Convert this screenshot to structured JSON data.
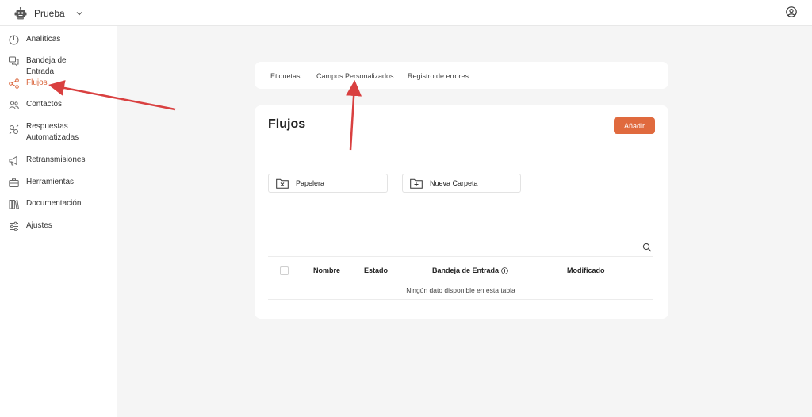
{
  "header": {
    "workspace_name": "Prueba",
    "workspace_icon": "robot-icon",
    "account_icon": "user-circle-icon"
  },
  "sidebar": {
    "items": [
      {
        "label": "Analíticas",
        "icon": "chart-pie-icon"
      },
      {
        "label": "Bandeja de Entrada",
        "icon": "chat-bubbles-icon"
      },
      {
        "label": "Flujos",
        "icon": "flow-nodes-icon",
        "active": true
      },
      {
        "label": "Contactos",
        "icon": "users-icon"
      },
      {
        "label": "Respuestas Automatizadas",
        "icon": "auto-reply-icon"
      },
      {
        "label": "Retransmisiones",
        "icon": "megaphone-icon"
      },
      {
        "label": "Herramientas",
        "icon": "toolbox-icon"
      },
      {
        "label": "Documentación",
        "icon": "books-icon"
      },
      {
        "label": "Ajustes",
        "icon": "sliders-icon"
      }
    ]
  },
  "tabs": [
    "Etiquetas",
    "Campos Personalizados",
    "Registro de errores"
  ],
  "main": {
    "title": "Flujos",
    "add_button": "Añadir",
    "folders": [
      {
        "label": "Papelera",
        "icon": "folder-x-icon"
      },
      {
        "label": "Nueva Carpeta",
        "icon": "folder-plus-icon"
      }
    ],
    "table": {
      "columns": [
        "Nombre",
        "Estado",
        "Bandeja de Entrada",
        "Modificado"
      ],
      "empty_message": "Ningún dato disponible en esta tabla"
    }
  },
  "colors": {
    "accent": "#e06a3e",
    "annotation_arrow": "#d94040",
    "background": "#f5f5f5"
  }
}
